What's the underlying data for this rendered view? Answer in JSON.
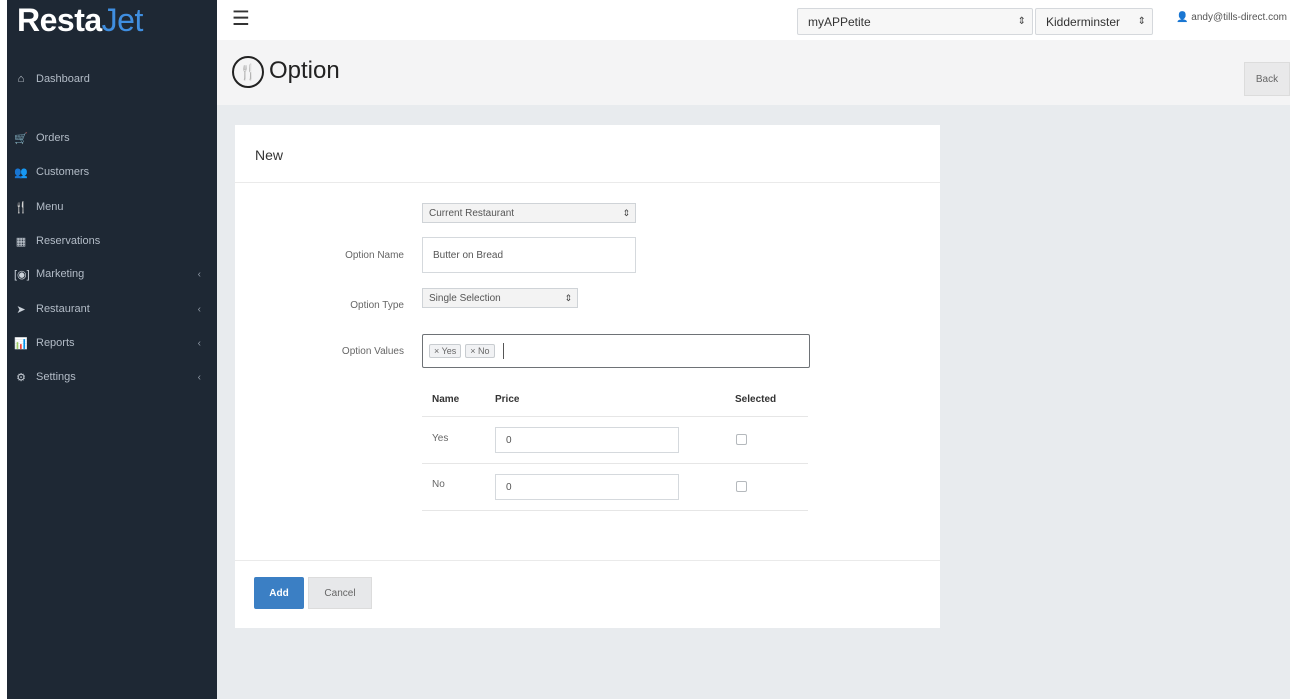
{
  "brand": {
    "part1": "Resta",
    "part2": "Jet"
  },
  "sidebar": {
    "items": [
      {
        "label": "Dashboard",
        "icon": "dashboard-icon",
        "glyph": "⌂",
        "has_caret": false
      },
      {
        "label": "Orders",
        "icon": "cart-icon",
        "glyph": "🛒",
        "has_caret": false
      },
      {
        "label": "Customers",
        "icon": "users-icon",
        "glyph": "👥",
        "has_caret": false
      },
      {
        "label": "Menu",
        "icon": "cutlery-icon",
        "glyph": "🍴",
        "has_caret": false
      },
      {
        "label": "Reservations",
        "icon": "calendar-icon",
        "glyph": "▦",
        "has_caret": false
      },
      {
        "label": "Marketing",
        "icon": "marketing-icon",
        "glyph": "[◉]",
        "has_caret": true
      },
      {
        "label": "Restaurant",
        "icon": "location-arrow-icon",
        "glyph": "➤",
        "has_caret": true
      },
      {
        "label": "Reports",
        "icon": "bar-chart-icon",
        "glyph": "📊",
        "has_caret": true
      },
      {
        "label": "Settings",
        "icon": "gear-icon",
        "glyph": "⚙",
        "has_caret": true
      }
    ],
    "caret_glyph": "‹"
  },
  "topbar": {
    "app_select": "myAPPetite",
    "location_select": "Kidderminster",
    "user": "andy@tills-direct.com",
    "arrows": "⇕"
  },
  "header": {
    "title": "Option",
    "back_label": "Back"
  },
  "form": {
    "panel_title": "New",
    "scope_select": "Current Restaurant",
    "option_name_label": "Option Name",
    "option_name_value": "Butter on Bread",
    "option_type_label": "Option Type",
    "option_type_value": "Single Selection",
    "option_values_label": "Option Values",
    "tags": [
      "× Yes",
      "× No"
    ],
    "table": {
      "headers": {
        "name": "Name",
        "price": "Price",
        "selected": "Selected"
      },
      "rows": [
        {
          "name": "Yes",
          "price": "0",
          "selected": false
        },
        {
          "name": "No",
          "price": "0",
          "selected": false
        }
      ]
    },
    "add_label": "Add",
    "cancel_label": "Cancel"
  }
}
